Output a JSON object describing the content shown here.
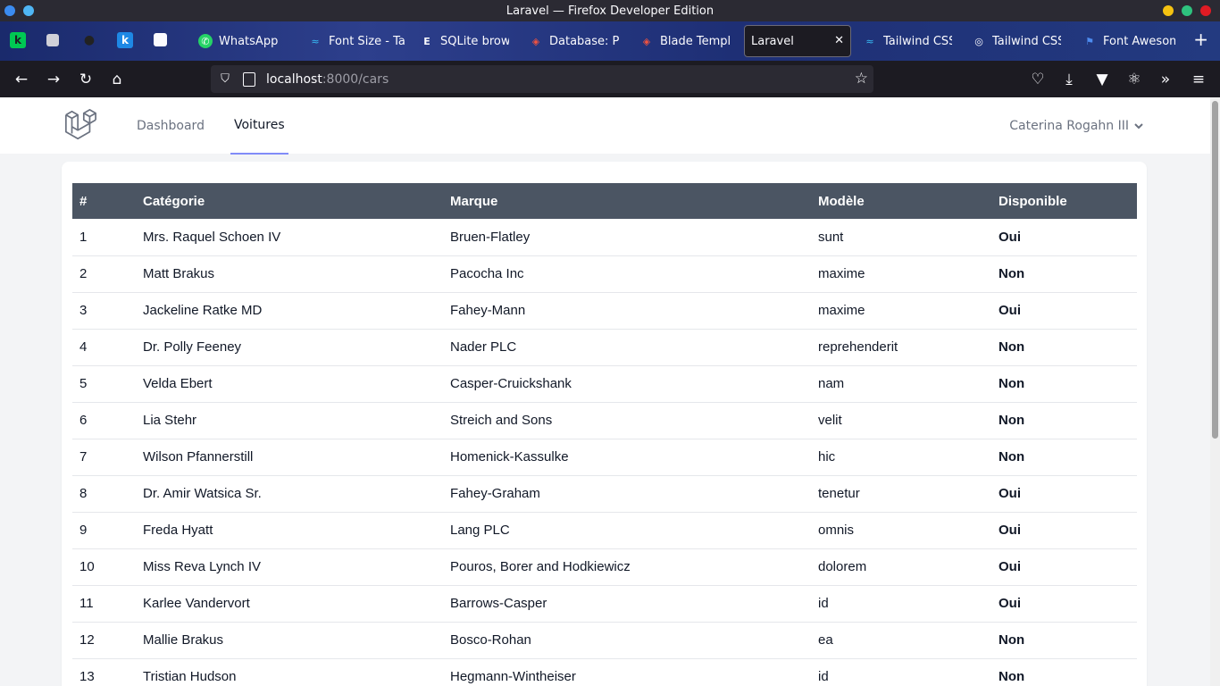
{
  "window": {
    "title": "Laravel — Firefox Developer Edition"
  },
  "tabs": [
    {
      "label": "WhatsApp"
    },
    {
      "label": "Font Size - Tai"
    },
    {
      "label": "SQLite brows"
    },
    {
      "label": "Database: P"
    },
    {
      "label": "Blade Templ"
    },
    {
      "label": "Laravel"
    },
    {
      "label": "Tailwind CSS"
    },
    {
      "label": "Tailwind CSS"
    },
    {
      "label": "Font Awesom"
    }
  ],
  "url": {
    "host": "localhost",
    "path": ":8000/cars"
  },
  "app": {
    "nav": [
      {
        "label": "Dashboard"
      },
      {
        "label": "Voitures"
      }
    ],
    "user": "Caterina Rogahn III"
  },
  "table": {
    "headers": [
      "#",
      "Catégorie",
      "Marque",
      "Modèle",
      "Disponible"
    ],
    "rows": [
      [
        "1",
        "Mrs. Raquel Schoen IV",
        "Bruen-Flatley",
        "sunt",
        "Oui"
      ],
      [
        "2",
        "Matt Brakus",
        "Pacocha Inc",
        "maxime",
        "Non"
      ],
      [
        "3",
        "Jackeline Ratke MD",
        "Fahey-Mann",
        "maxime",
        "Oui"
      ],
      [
        "4",
        "Dr. Polly Feeney",
        "Nader PLC",
        "reprehenderit",
        "Non"
      ],
      [
        "5",
        "Velda Ebert",
        "Casper-Cruickshank",
        "nam",
        "Non"
      ],
      [
        "6",
        "Lia Stehr",
        "Streich and Sons",
        "velit",
        "Non"
      ],
      [
        "7",
        "Wilson Pfannerstill",
        "Homenick-Kassulke",
        "hic",
        "Non"
      ],
      [
        "8",
        "Dr. Amir Watsica Sr.",
        "Fahey-Graham",
        "tenetur",
        "Oui"
      ],
      [
        "9",
        "Freda Hyatt",
        "Lang PLC",
        "omnis",
        "Oui"
      ],
      [
        "10",
        "Miss Reva Lynch IV",
        "Pouros, Borer and Hodkiewicz",
        "dolorem",
        "Oui"
      ],
      [
        "11",
        "Karlee Vandervort",
        "Barrows-Casper",
        "id",
        "Oui"
      ],
      [
        "12",
        "Mallie Brakus",
        "Bosco-Rohan",
        "ea",
        "Non"
      ],
      [
        "13",
        "Tristian Hudson",
        "Hegmann-Wintheiser",
        "id",
        "Non"
      ]
    ]
  }
}
